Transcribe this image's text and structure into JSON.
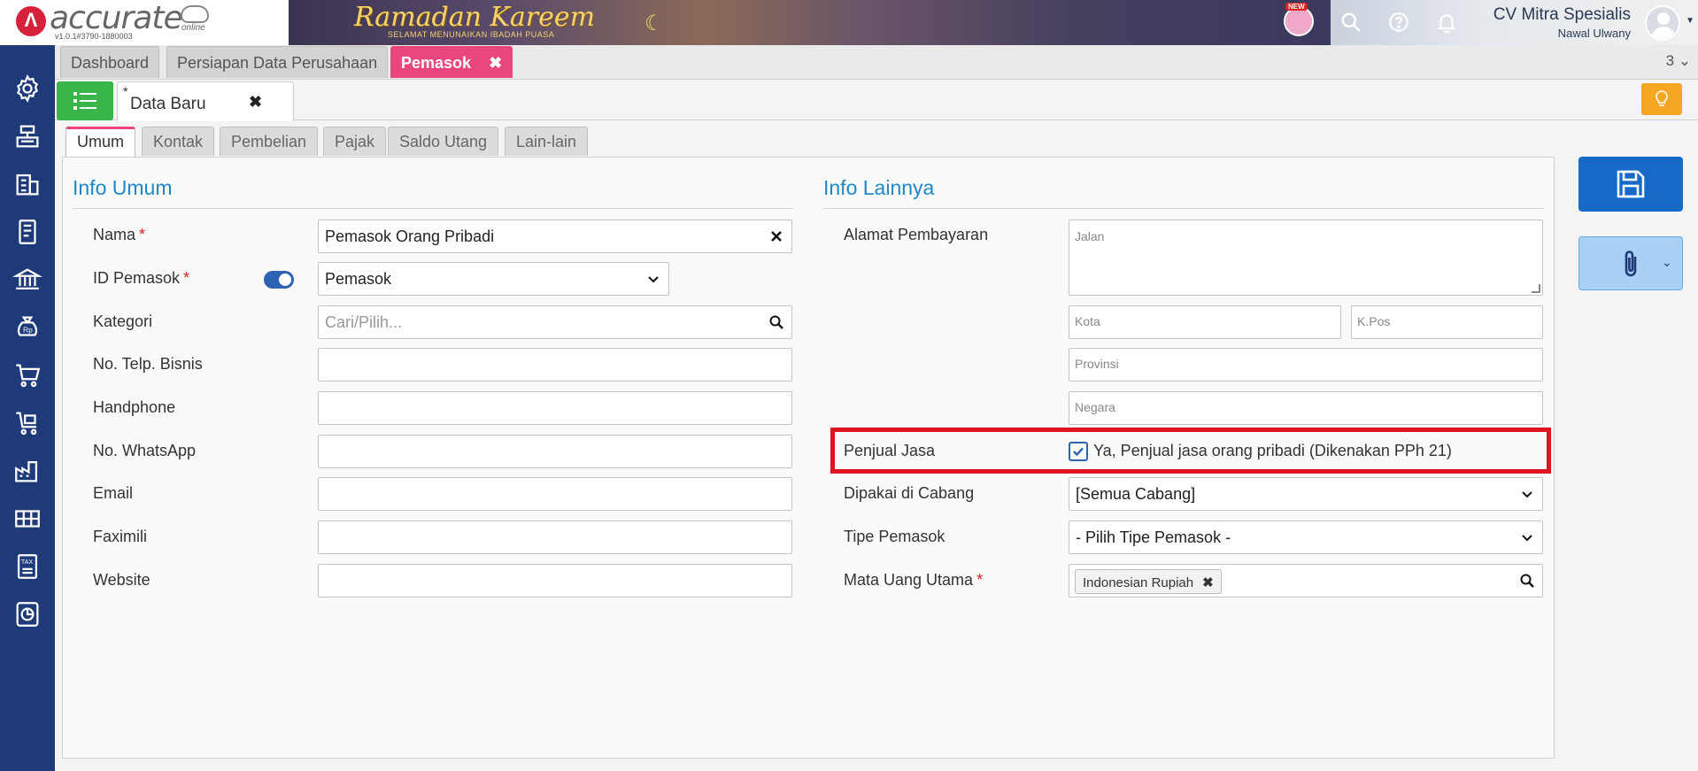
{
  "header": {
    "logo_text": "accurate",
    "logo_online": "online",
    "version": "v1.0.1#3790-1880003",
    "banner_title": "Ramadan Kareem",
    "banner_subtitle": "SELAMAT MENUNAIKAN IBADAH PUASA",
    "new_badge": "NEW",
    "company": "CV Mitra Spesialis",
    "user": "Nawal Ulwany"
  },
  "module_tabs": [
    {
      "label": "Dashboard"
    },
    {
      "label": "Persiapan Data Perusahaan"
    },
    {
      "label": "Pemasok",
      "active": true
    }
  ],
  "tab_count": "3",
  "doc_tab": {
    "star": "*",
    "label": "Data Baru"
  },
  "form_tabs": [
    "Umum",
    "Kontak",
    "Pembelian",
    "Pajak",
    "Saldo Utang",
    "Lain-lain"
  ],
  "info_umum": {
    "title": "Info Umum",
    "nama_label": "Nama",
    "nama_value": "Pemasok Orang Pribadi",
    "id_label": "ID Pemasok",
    "id_value": "Pemasok",
    "kategori_label": "Kategori",
    "kategori_placeholder": "Cari/Pilih...",
    "telp_label": "No. Telp. Bisnis",
    "hp_label": "Handphone",
    "wa_label": "No. WhatsApp",
    "email_label": "Email",
    "fax_label": "Faximili",
    "website_label": "Website"
  },
  "info_lainnya": {
    "title": "Info Lainnya",
    "alamat_label": "Alamat Pembayaran",
    "jalan_ph": "Jalan",
    "kota_ph": "Kota",
    "kpos_ph": "K.Pos",
    "provinsi_ph": "Provinsi",
    "negara_ph": "Negara",
    "penjual_label": "Penjual Jasa",
    "penjual_checkbox_label": "Ya, Penjual jasa orang pribadi (Dikenakan PPh 21)",
    "cabang_label": "Dipakai di Cabang",
    "cabang_value": "[Semua Cabang]",
    "tipe_label": "Tipe Pemasok",
    "tipe_value": "- Pilih Tipe Pemasok -",
    "mata_uang_label": "Mata Uang Utama",
    "mata_uang_value": "Indonesian Rupiah"
  },
  "required_mark": "*",
  "close_glyph": "✖",
  "colors": {
    "sidebar": "#1e3a78",
    "accent": "#e8467c",
    "title": "#1e88c8",
    "save": "#1769c7",
    "list_button": "#3ab54a",
    "tip_button": "#f5a623",
    "highlight": "#e0141e"
  }
}
